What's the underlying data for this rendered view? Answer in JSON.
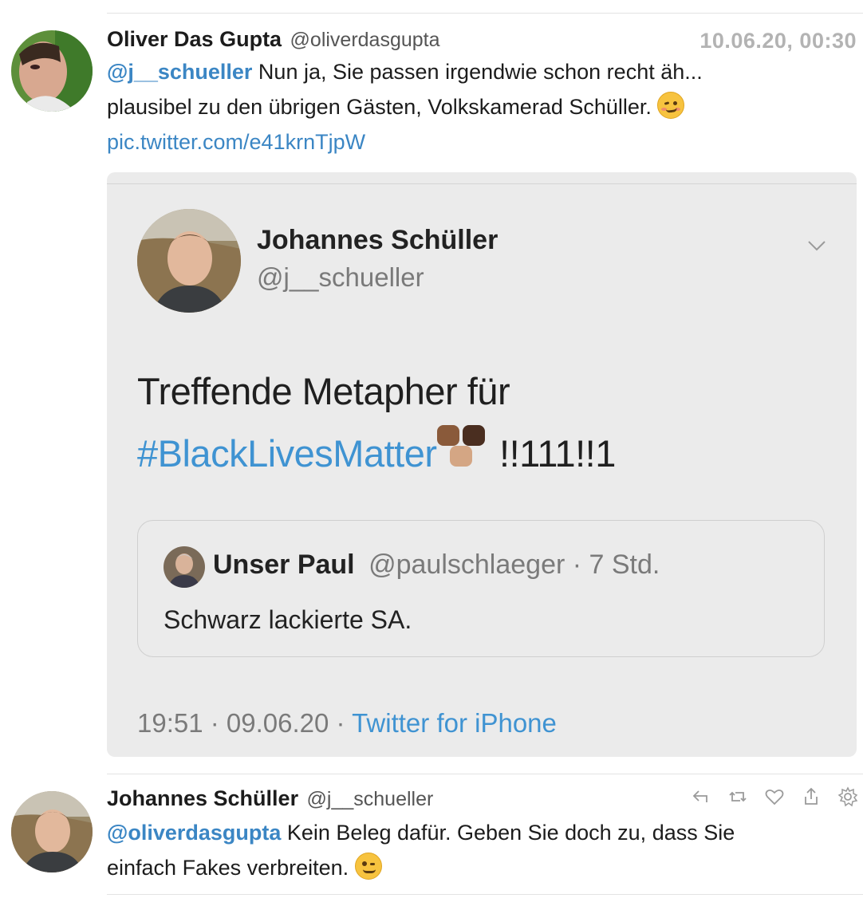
{
  "tweet1": {
    "name": "Oliver Das Gupta",
    "handle": "@oliverdasgupta",
    "timestamp": "10.06.20, 00:30",
    "mention": "@j__schueller",
    "text_line1": " Nun ja, Sie passen irgendwie schon recht äh...",
    "text_line2": "plausibel zu den übrigen Gästen, Volkskamerad Schüller.",
    "link": "pic.twitter.com/e41krnTjpW",
    "emoji_icon": "woozy-face-emoji"
  },
  "embed": {
    "name": "Johannes Schüller",
    "handle": "@j__schueller",
    "text_line1": "Treffende Metapher für",
    "hashtag": "#BlackLivesMatter",
    "text_suffix": " !!111!!1",
    "quote": {
      "name": "Unser Paul",
      "handle_time": "@paulschlaeger · 7 Std.",
      "text": "Schwarz lackierte SA."
    },
    "footer_time": "19:51 · 09.06.20 · ",
    "footer_source": "Twitter for iPhone"
  },
  "tweet2": {
    "name": "Johannes Schüller",
    "handle": "@j__schueller",
    "mention": "@oliverdasgupta",
    "text_line1": " Kein Beleg dafür. Geben Sie doch zu, dass Sie",
    "text_line2": "einfach Fakes verbreiten.",
    "emoji_icon": "winking-face-emoji",
    "actions": [
      "reply-icon",
      "retweet-icon",
      "like-icon",
      "share-icon",
      "settings-icon"
    ]
  },
  "colors": {
    "link": "#3b86c4",
    "hashtag": "#3f93d2",
    "embed_bg": "#ebebeb",
    "timestamp": "#b3b3b3"
  }
}
